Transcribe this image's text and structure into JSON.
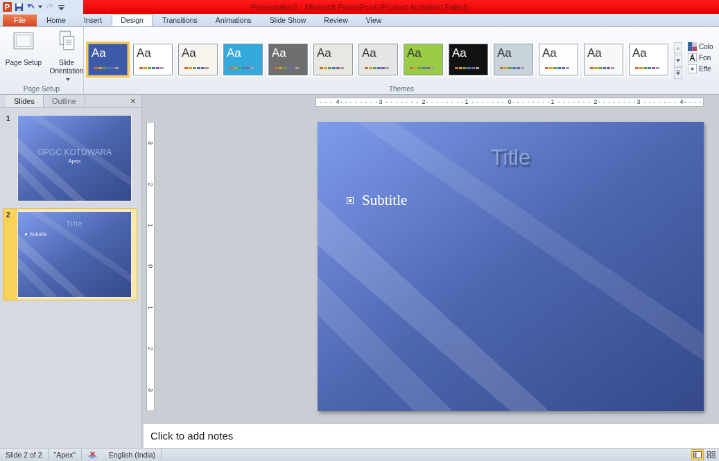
{
  "window": {
    "title": "Presentation1  -  Microsoft PowerPoint (Product Activation Failed)",
    "app_letter": "P"
  },
  "ribbon_tabs": [
    {
      "label": "File",
      "kind": "file",
      "selected": false
    },
    {
      "label": "Home",
      "kind": "tab",
      "selected": false
    },
    {
      "label": "Insert",
      "kind": "tab",
      "selected": false
    },
    {
      "label": "Design",
      "kind": "tab",
      "selected": true
    },
    {
      "label": "Transitions",
      "kind": "tab",
      "selected": false
    },
    {
      "label": "Animations",
      "kind": "tab",
      "selected": false
    },
    {
      "label": "Slide Show",
      "kind": "tab",
      "selected": false
    },
    {
      "label": "Review",
      "kind": "tab",
      "selected": false
    },
    {
      "label": "View",
      "kind": "tab",
      "selected": false
    }
  ],
  "page_setup": {
    "buttons": [
      {
        "label": "Page Setup",
        "kind": "page"
      },
      {
        "label": "Slide Orientation",
        "kind": "orientation",
        "dropdown": true
      }
    ],
    "group_label": "Page Setup"
  },
  "themes": {
    "group_label": "Themes",
    "items": [
      {
        "label": "Aa",
        "color": "#3d5aa8",
        "selected": true
      },
      {
        "label": "Aa",
        "color": "#ffffff",
        "selected": false
      },
      {
        "label": "Aa",
        "color": "#f7f5ee",
        "selected": false
      },
      {
        "label": "Aa",
        "color": "#35a9dc",
        "selected": false
      },
      {
        "label": "Aa",
        "color": "#6e6e6e",
        "selected": false
      },
      {
        "label": "Aa",
        "color": "#e8e8e2",
        "selected": false
      },
      {
        "label": "Aa",
        "color": "#e6e6e6",
        "selected": false
      },
      {
        "label": "Aa",
        "color": "#9acb45",
        "selected": false
      },
      {
        "label": "Aa",
        "color": "#111111",
        "selected": false
      },
      {
        "label": "Aa",
        "color": "#c8d4da",
        "selected": false
      },
      {
        "label": "Aa",
        "color": "#fdfdfd",
        "selected": false
      },
      {
        "label": "Aa",
        "color": "#f8f8f8",
        "selected": false
      },
      {
        "label": "Aa",
        "color": "#ffffff",
        "selected": false
      }
    ]
  },
  "theme_options": [
    {
      "label": "Colo",
      "kind": "colors"
    },
    {
      "label": "Fon",
      "kind": "fonts"
    },
    {
      "label": "Effe",
      "kind": "effects"
    }
  ],
  "side_panel": {
    "tabs": [
      {
        "label": "Slides",
        "selected": true
      },
      {
        "label": "Outline",
        "selected": false
      }
    ],
    "close": "×",
    "slides": [
      {
        "number": "1",
        "title": "GPGC KOTDWARA",
        "subtitle": "Apex",
        "kind": "title",
        "selected": false
      },
      {
        "number": "2",
        "title": "Title",
        "subtitle": "Subtitle",
        "kind": "bullets",
        "selected": true
      }
    ]
  },
  "horizontal_ruler": [
    "4",
    "3",
    "2",
    "1",
    "0",
    "1",
    "2",
    "3",
    "4"
  ],
  "vertical_ruler": [
    "3",
    "2",
    "1",
    "0",
    "1",
    "2",
    "3"
  ],
  "slide": {
    "title": "Title",
    "subtitle": "Subtitle"
  },
  "notes": {
    "placeholder": "Click to add notes"
  },
  "status_bar": {
    "slide": "Slide 2 of 2",
    "theme": "\"Apex\"",
    "language": "English (India)",
    "views": [
      {
        "kind": "normal",
        "selected": true
      },
      {
        "kind": "sorter",
        "selected": false
      }
    ]
  }
}
